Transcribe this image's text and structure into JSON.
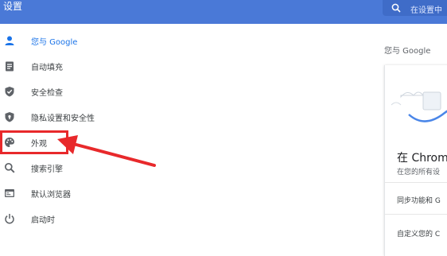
{
  "header": {
    "title": "设置",
    "search_placeholder": "在设置中"
  },
  "sidebar": {
    "items": [
      {
        "label": "您与 Google",
        "icon": "person-icon"
      },
      {
        "label": "自动填充",
        "icon": "clipboard-icon"
      },
      {
        "label": "安全检查",
        "icon": "shield-check-icon"
      },
      {
        "label": "隐私设置和安全性",
        "icon": "shield-lock-icon"
      },
      {
        "label": "外观",
        "icon": "palette-icon"
      },
      {
        "label": "搜索引擎",
        "icon": "search-icon"
      },
      {
        "label": "默认浏览器",
        "icon": "browser-icon"
      },
      {
        "label": "启动时",
        "icon": "power-icon"
      }
    ]
  },
  "main": {
    "section_title": "您与 Google",
    "card": {
      "heading": "在 Chrom",
      "subtitle": "在您的所有设",
      "row1": "同步功能和 G",
      "row2": "自定义您的 C"
    }
  },
  "colors": {
    "header_bg": "#4a79d7",
    "accent": "#1a73e8",
    "annotation_red": "#e8292b"
  }
}
